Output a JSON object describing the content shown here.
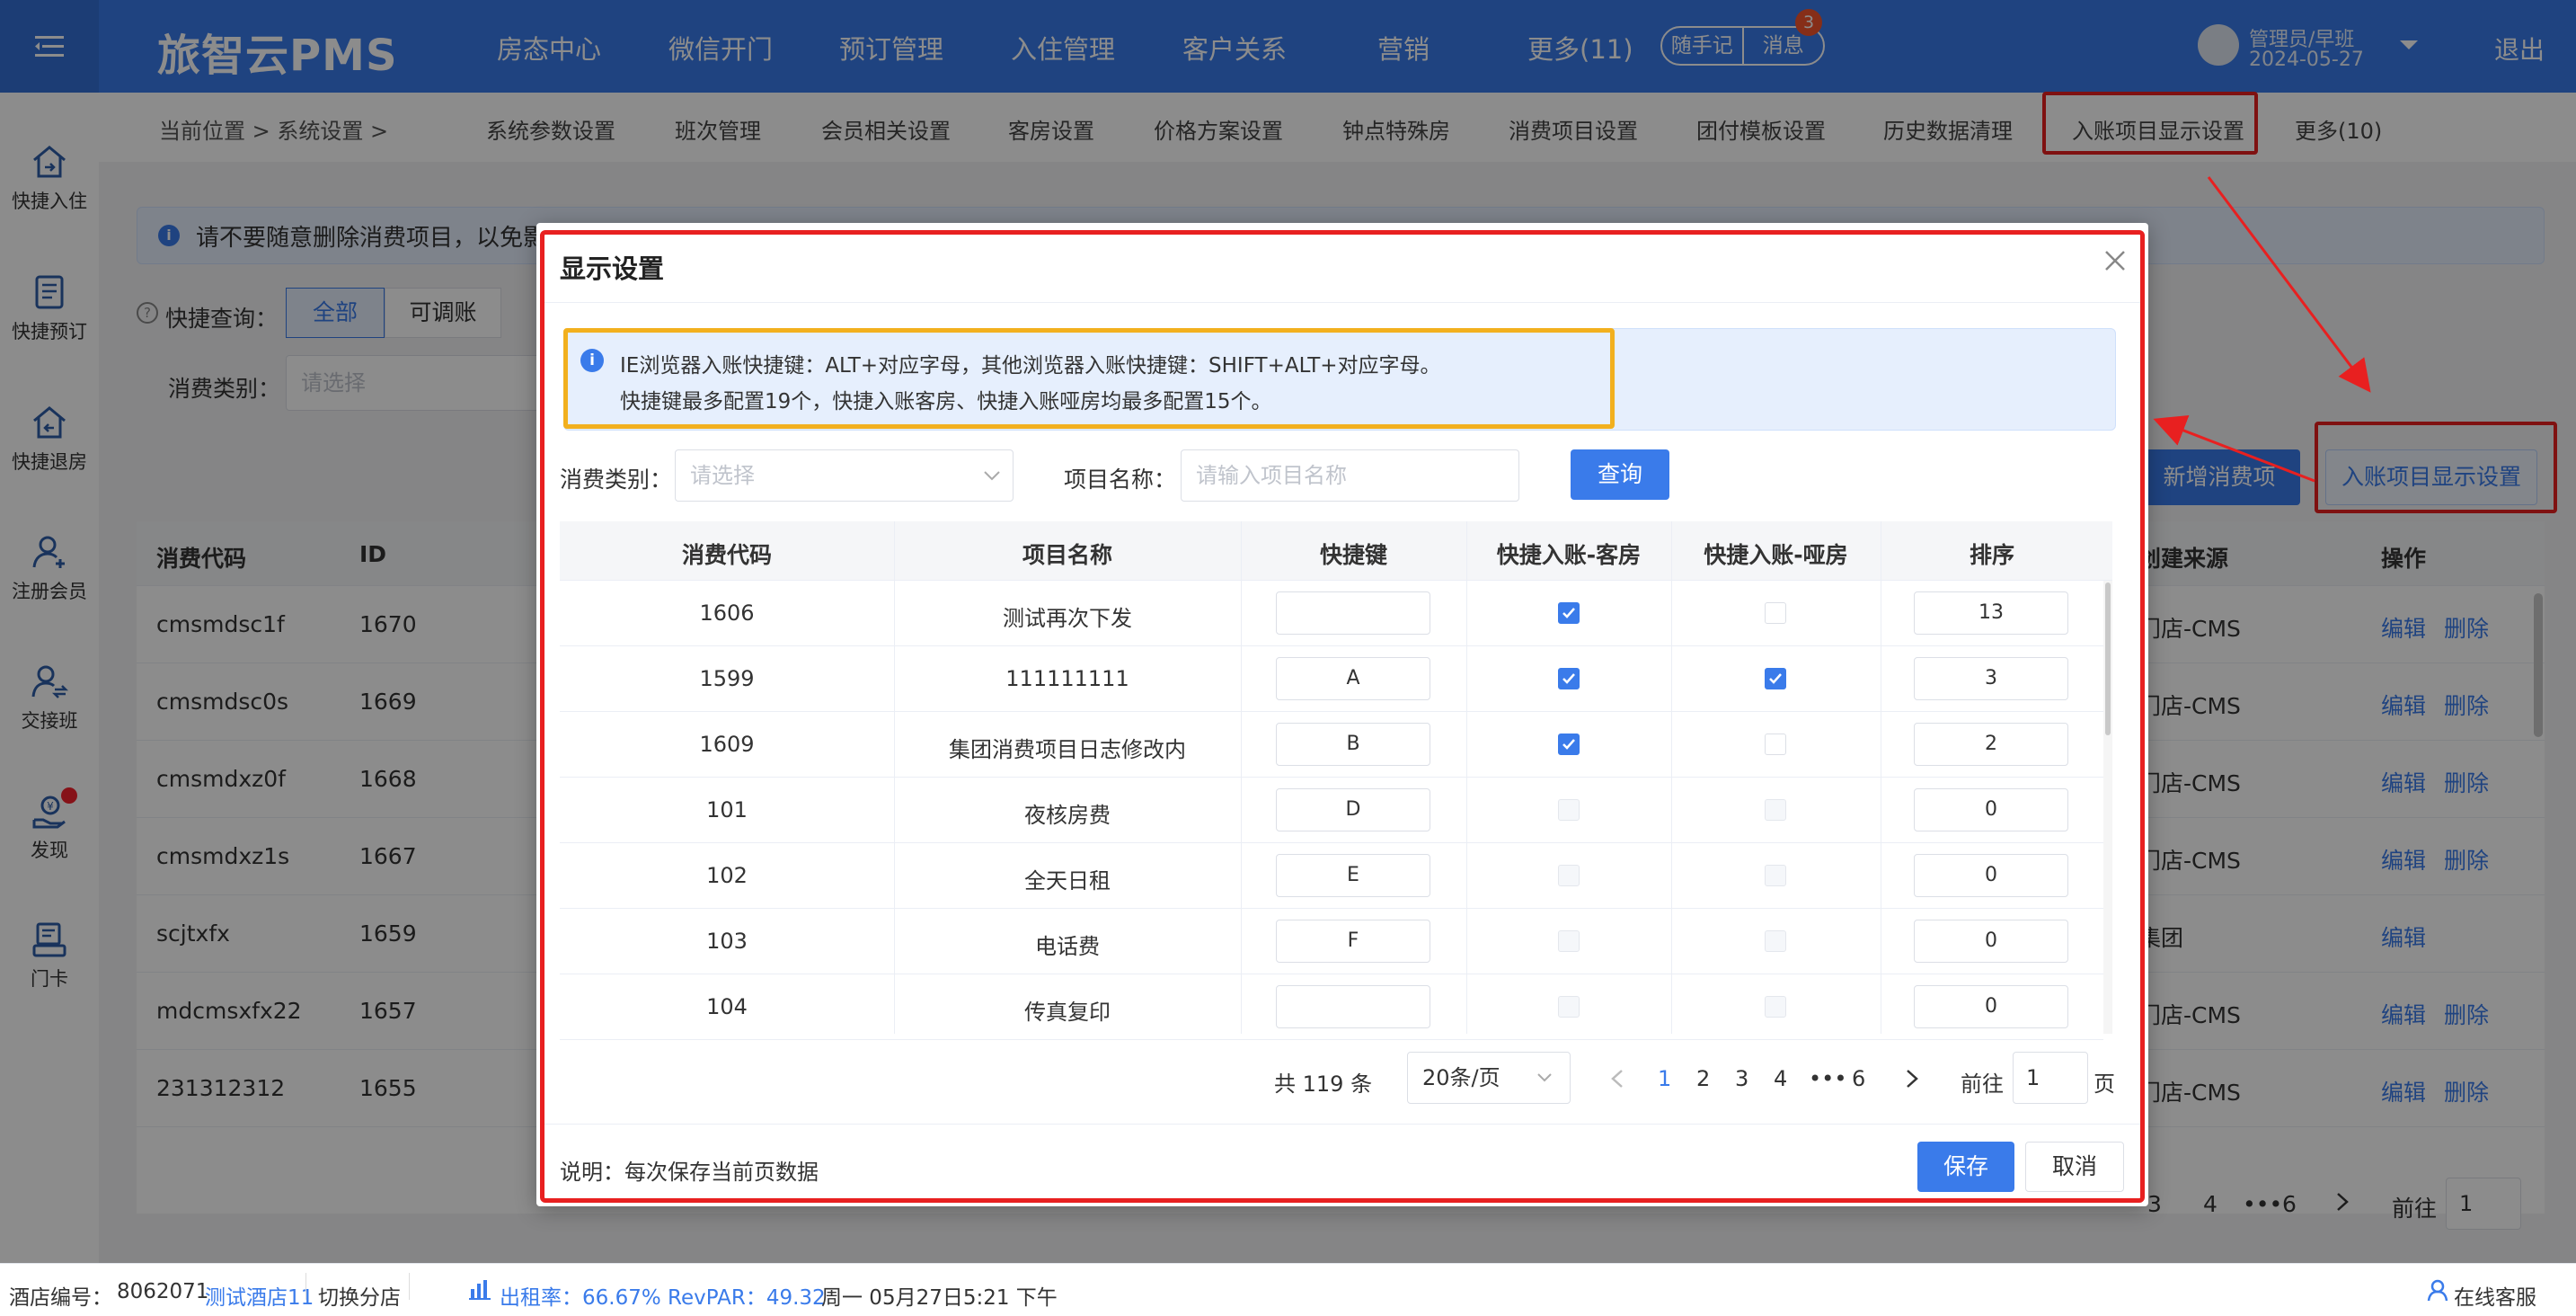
{
  "app": {
    "logo": "旅智云PMS",
    "logout": "退出"
  },
  "topnav": [
    "房态中心",
    "微信开门",
    "预订管理",
    "入住管理",
    "客户关系",
    "营销",
    "更多(11)"
  ],
  "topbar": {
    "note_label": "随手记",
    "msg_label": "消息",
    "msg_count": "3",
    "user_name": "管理员/早班",
    "user_date": "2024-05-27"
  },
  "sidebar": [
    {
      "label": "快捷入住",
      "icon": "home-in-icon"
    },
    {
      "label": "快捷预订",
      "icon": "booking-list-icon"
    },
    {
      "label": "快捷退房",
      "icon": "home-out-icon"
    },
    {
      "label": "注册会员",
      "icon": "add-member-icon"
    },
    {
      "label": "交接班",
      "icon": "handover-icon"
    },
    {
      "label": "发现",
      "icon": "discover-icon"
    },
    {
      "label": "门卡",
      "icon": "door-card-icon"
    }
  ],
  "subnav": {
    "breadcrumb": "当前位置  >  系统设置  >",
    "items": [
      "系统参数设置",
      "班次管理",
      "会员相关设置",
      "客房设置",
      "价格方案设置",
      "钟点特殊房",
      "消费项目设置",
      "团付模板设置",
      "历史数据清理",
      "入账项目显示设置",
      "更多(10)"
    ]
  },
  "background": {
    "info": "请不要随意删除消费项目，以免影",
    "quick_query": "快捷查询：",
    "seg": [
      "全部",
      "可调账"
    ],
    "cat_label": "消费类别：",
    "cat_placeholder": "请选择",
    "new_btn": "新增消费项",
    "display_btn": "入账项目显示设置",
    "headers": [
      "消费代码",
      "ID",
      "创建来源",
      "操作"
    ],
    "rows": [
      {
        "code": "cmsmdsc1f",
        "id": "1670",
        "source": "门店-CMS",
        "edit": "编辑",
        "del": "删除"
      },
      {
        "code": "cmsmdsc0s",
        "id": "1669",
        "source": "门店-CMS",
        "edit": "编辑",
        "del": "删除"
      },
      {
        "code": "cmsmdxz0f",
        "id": "1668",
        "source": "门店-CMS",
        "edit": "编辑",
        "del": "删除"
      },
      {
        "code": "cmsmdxz1s",
        "id": "1667",
        "source": "门店-CMS",
        "edit": "编辑",
        "del": "删除"
      },
      {
        "code": "scjtxfx",
        "id": "1659",
        "source": "集团",
        "edit": "编辑",
        "del": ""
      },
      {
        "code": "mdcmsxfx22",
        "id": "1657",
        "source": "门店-CMS",
        "edit": "编辑",
        "del": "删除"
      },
      {
        "code": "231312312",
        "id": "1655",
        "source": "门店-CMS",
        "edit": "编辑",
        "del": "删除"
      }
    ],
    "pager": {
      "pages": [
        "3",
        "4",
        "•••",
        "6"
      ],
      "goto": "前往",
      "goto_value": "1"
    }
  },
  "dialog": {
    "title": "显示设置",
    "info_line1": "IE浏览器入账快捷键：ALT+对应字母，其他浏览器入账快捷键：SHIFT+ALT+对应字母。",
    "info_line2": "快捷键最多配置19个，快捷入账客房、快捷入账哑房均最多配置15个。",
    "cat_label": "消费类别：",
    "cat_placeholder": "请选择",
    "name_label": "项目名称：",
    "name_placeholder": "请输入项目名称",
    "query_btn": "查询",
    "headers": [
      "消费代码",
      "项目名称",
      "快捷键",
      "快捷入账-客房",
      "快捷入账-哑房",
      "排序"
    ],
    "rows": [
      {
        "code": "1606",
        "name": "测试再次下发",
        "key": "",
        "guest": true,
        "dummy": false,
        "sort": "13"
      },
      {
        "code": "1599",
        "name": "111111111",
        "key": "A",
        "guest": true,
        "dummy": true,
        "sort": "3"
      },
      {
        "code": "1609",
        "name": "集团消费项目日志修改内",
        "key": "B",
        "guest": true,
        "dummy": false,
        "sort": "2"
      },
      {
        "code": "101",
        "name": "夜核房费",
        "key": "D",
        "guest": false,
        "dummy": false,
        "sort": "0"
      },
      {
        "code": "102",
        "name": "全天日租",
        "key": "E",
        "guest": false,
        "dummy": false,
        "sort": "0"
      },
      {
        "code": "103",
        "name": "电话费",
        "key": "F",
        "guest": false,
        "dummy": false,
        "sort": "0"
      },
      {
        "code": "104",
        "name": "传真复印",
        "key": "",
        "guest": false,
        "dummy": false,
        "sort": "0"
      }
    ],
    "pager": {
      "total": "共 119 条",
      "page_size": "20条/页",
      "pages": [
        "1",
        "2",
        "3",
        "4",
        "•••",
        "6"
      ],
      "goto": "前往",
      "goto_value": "1",
      "page_suffix": "页"
    },
    "note": "说明：每次保存当前页数据",
    "save_btn": "保存",
    "cancel_btn": "取消"
  },
  "statusbar": {
    "hotel_no_label": "酒店编号：",
    "hotel_no": "8062071",
    "hotel_name": "测试酒店11",
    "switch": "切换分店",
    "occ": "出租率：66.67% RevPAR：49.32",
    "datetime": "周一 05月27日5:21 下午",
    "service": "在线客服"
  },
  "colors": {
    "primary": "#3a7bea",
    "highlight_red": "#e82020",
    "highlight_yellow": "#f2b01e"
  }
}
